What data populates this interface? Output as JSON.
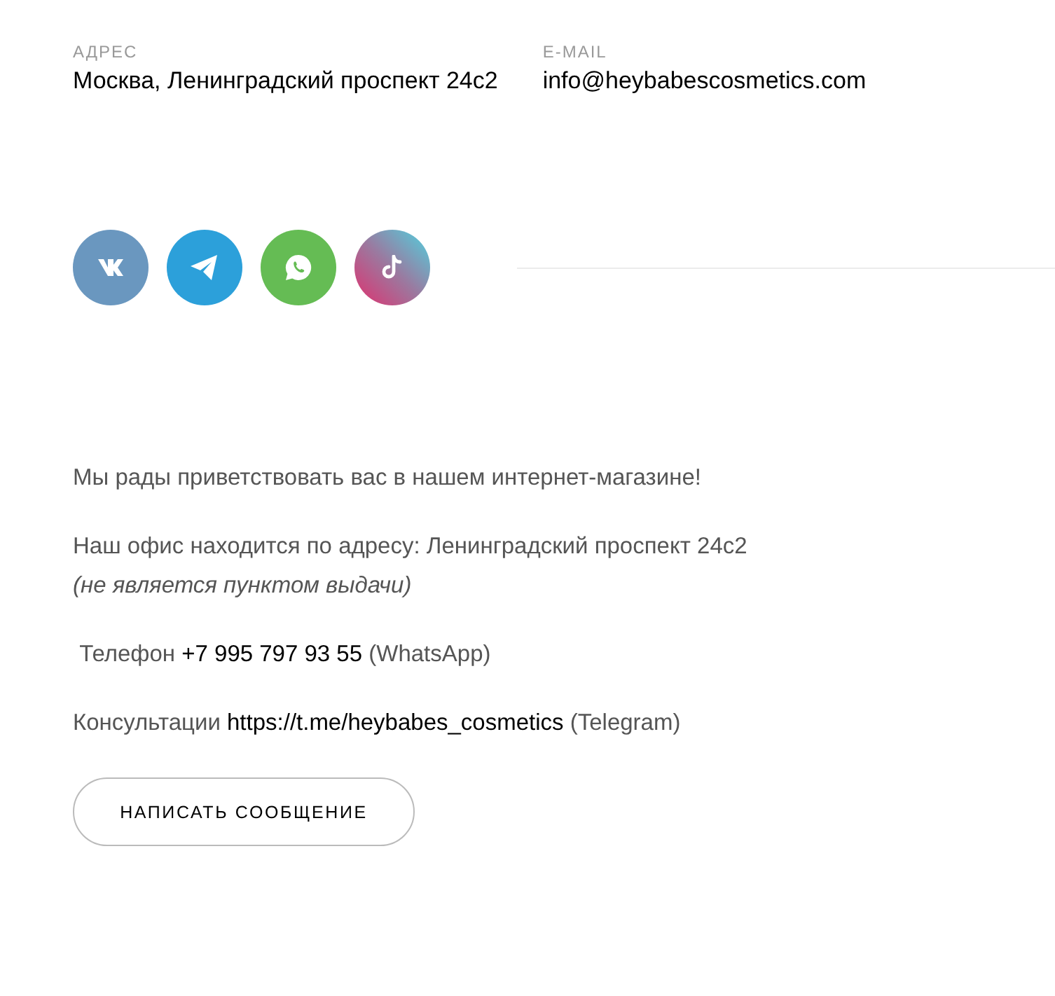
{
  "contacts": [
    {
      "label": "АДРЕС",
      "value": "Москва, Ленинградский проспект 24с2"
    },
    {
      "label": "E-MAIL",
      "value": "info@heybabescosmetics.com"
    }
  ],
  "socials": [
    {
      "kind": "vk"
    },
    {
      "kind": "telegram"
    },
    {
      "kind": "whatsapp"
    },
    {
      "kind": "tiktok"
    }
  ],
  "paragraphs": [
    {
      "lines": [
        [
          {
            "kind": "text",
            "text": "Мы рады приветствовать вас в нашем интернет-магазине!"
          }
        ]
      ]
    },
    {
      "lines": [
        [
          {
            "kind": "text",
            "text": "Наш офис находится по адресу: Ленинградский проспект 24с2"
          }
        ],
        [
          {
            "kind": "italic",
            "text": "(не является пунктом выдачи)"
          }
        ]
      ]
    },
    {
      "lines": [
        [
          {
            "kind": "text",
            "text": " Телефон "
          },
          {
            "kind": "link",
            "text": "+7 995 797 93 55"
          },
          {
            "kind": "text",
            "text": " (WhatsApp)"
          }
        ]
      ]
    },
    {
      "lines": [
        [
          {
            "kind": "text",
            "text": "Консультации "
          },
          {
            "kind": "link",
            "text": "https://t.me/heybabes_cosmetics"
          },
          {
            "kind": "text",
            "text": " (Telegram)"
          }
        ]
      ]
    }
  ],
  "button": "НАПИСАТЬ СООБЩЕНИЕ"
}
